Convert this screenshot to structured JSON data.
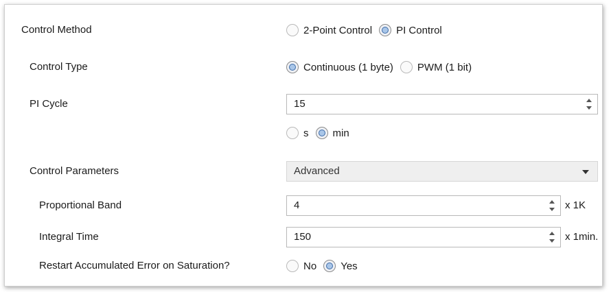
{
  "control_method": {
    "label": "Control Method",
    "options": [
      {
        "label": "2-Point Control",
        "selected": false
      },
      {
        "label": "PI Control",
        "selected": true
      }
    ]
  },
  "control_type": {
    "label": "Control Type",
    "options": [
      {
        "label": "Continuous (1 byte)",
        "selected": true
      },
      {
        "label": "PWM (1 bit)",
        "selected": false
      }
    ]
  },
  "pi_cycle": {
    "label": "PI Cycle",
    "value": "15",
    "unit_options": [
      {
        "label": "s",
        "selected": false
      },
      {
        "label": "min",
        "selected": true
      }
    ]
  },
  "control_parameters": {
    "label": "Control Parameters",
    "value": "Advanced"
  },
  "proportional_band": {
    "label": "Proportional Band",
    "value": "4",
    "unit": "x 1K"
  },
  "integral_time": {
    "label": "Integral Time",
    "value": "150",
    "unit": "x 1min."
  },
  "restart_error": {
    "label": "Restart Accumulated Error on Saturation?",
    "options": [
      {
        "label": "No",
        "selected": false
      },
      {
        "label": "Yes",
        "selected": true
      }
    ]
  },
  "colors": {
    "radio_selected_fill": "#a9c6e8",
    "radio_selected_ring": "#3b6aa8",
    "dropdown_bg": "#efefef",
    "field_border": "#b8b8b8"
  }
}
